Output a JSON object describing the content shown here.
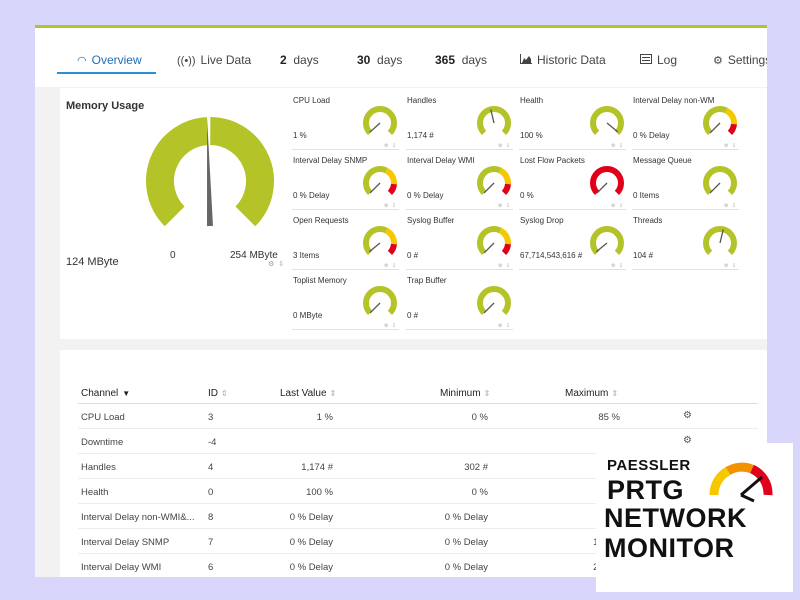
{
  "tabs": [
    {
      "label": "Overview",
      "active": true,
      "icon": "gauge-icon"
    },
    {
      "label": "Live Data",
      "icon": "broadcast-icon"
    },
    {
      "num": "2",
      "label": "days"
    },
    {
      "num": "30",
      "label": "days"
    },
    {
      "num": "365",
      "label": "days"
    },
    {
      "label": "Historic Data",
      "icon": "area-chart-icon"
    },
    {
      "label": "Log",
      "icon": "log-icon"
    },
    {
      "label": "Settings",
      "icon": "gear-icon"
    }
  ],
  "memory": {
    "title": "Memory Usage",
    "value": "124 MByte",
    "min": "0",
    "max": "254 MByte",
    "fill_fraction": 0.49
  },
  "gauges": [
    {
      "title": "CPU Load",
      "value": "1 %",
      "level": 0.01,
      "warn_start": null
    },
    {
      "title": "Handles",
      "value": "1,174 #",
      "level": 0.45,
      "warn_start": null
    },
    {
      "title": "Health",
      "value": "100 %",
      "level": 0.98,
      "warn_start": null
    },
    {
      "title": "Interval Delay non-WMI...",
      "value": "0 % Delay",
      "level": 0.0,
      "warn_start": 0.6
    },
    {
      "title": "Interval Delay SNMP",
      "value": "0 % Delay",
      "level": 0.0,
      "warn_start": 0.6
    },
    {
      "title": "Interval Delay WMI",
      "value": "0 % Delay",
      "level": 0.0,
      "warn_start": 0.6
    },
    {
      "title": "Lost Flow Packets",
      "value": "0 %",
      "level": 0.0,
      "warn_start": 0.0
    },
    {
      "title": "Message Queue",
      "value": "0 Items",
      "level": 0.0,
      "warn_start": null
    },
    {
      "title": "Open Requests",
      "value": "3 Items",
      "level": 0.02,
      "warn_start": 0.6
    },
    {
      "title": "Syslog Buffer",
      "value": "0 #",
      "level": 0.0,
      "warn_start": 0.6
    },
    {
      "title": "Syslog Drop",
      "value": "67,714,543,616 #",
      "level": 0.02,
      "warn_start": null
    },
    {
      "title": "Threads",
      "value": "104 #",
      "level": 0.55,
      "warn_start": null
    },
    {
      "title": "Toplist Memory",
      "value": "0 MByte",
      "level": 0.0,
      "warn_start": null
    },
    {
      "title": "Trap Buffer",
      "value": "0 #",
      "level": 0.0,
      "warn_start": null
    }
  ],
  "table": {
    "headers": {
      "channel": "Channel",
      "id": "ID",
      "last_value": "Last Value",
      "minimum": "Minimum",
      "maximum": "Maximum"
    },
    "rows": [
      {
        "channel": "CPU Load",
        "id": "3",
        "last": "1 %",
        "min": "0 %",
        "max": "85 %"
      },
      {
        "channel": "Downtime",
        "id": "-4",
        "last": "",
        "min": "",
        "max": ""
      },
      {
        "channel": "Handles",
        "id": "4",
        "last": "1,174 #",
        "min": "302 #",
        "max": "5,"
      },
      {
        "channel": "Health",
        "id": "0",
        "last": "100 %",
        "min": "0 %",
        "max": "1"
      },
      {
        "channel": "Interval Delay non-WMI&...",
        "id": "8",
        "last": "0 % Delay",
        "min": "0 % Delay",
        "max": "95 %"
      },
      {
        "channel": "Interval Delay SNMP",
        "id": "7",
        "last": "0 % Delay",
        "min": "0 % Delay",
        "max": "109 %"
      },
      {
        "channel": "Interval Delay WMI",
        "id": "6",
        "last": "0 % Delay",
        "min": "0 % Delay",
        "max": "222 %"
      }
    ]
  },
  "logo": {
    "line1": "PAESSLER",
    "line2": "PRTG",
    "line3": "NETWORK",
    "line4": "MONITOR"
  },
  "colors": {
    "gauge_green": "#b4c428",
    "gauge_yellow": "#f5c800",
    "gauge_red": "#e0001a",
    "accent_blue": "#2c8fd6",
    "logo_orange": "#f39200"
  }
}
